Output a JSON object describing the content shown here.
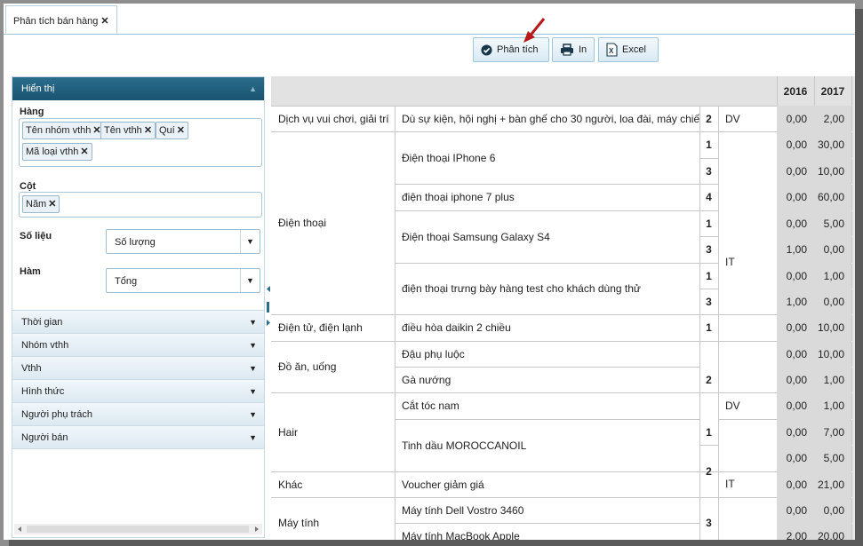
{
  "tab": {
    "label": "Phân tích bán hàng"
  },
  "toolbar": {
    "analyze_label": "Phân tích",
    "print_label": "In",
    "excel_label": "Excel"
  },
  "panel": {
    "title": "Hiển thị",
    "rows_label": "Hàng",
    "row_chips": [
      "Tên nhóm vthh",
      "Tên vthh",
      "Quí",
      "Mã loại vthh"
    ],
    "cols_label": "Cột",
    "col_chips": [
      "Năm"
    ],
    "measure_label": "Số liệu",
    "measure_value": "Số lượng",
    "func_label": "Hàm",
    "func_value": "Tổng",
    "filters": [
      "Thời gian",
      "Nhóm vthh",
      "Vthh",
      "Hình thức",
      "Người phụ trách",
      "Người bán"
    ]
  },
  "table": {
    "years": [
      "2016",
      "2017"
    ],
    "groups": [
      "Dịch vụ vui chơi, giải trí",
      "Điện thoại",
      "Điện tử, điện lạnh",
      "Đồ ăn, uống",
      "Hair",
      "Khác",
      "Máy tính"
    ],
    "items": [
      "Dù sự kiện, hội nghị + bàn ghế cho 30 người, loa đài, máy chiếu",
      "Điện thoại IPhone 6",
      "điện thoại iphone 7 plus",
      "Điện thoại Samsung Galaxy S4",
      "điện thoại trưng bày hàng test cho khách dùng thử",
      "điều hòa daikin 2 chiều",
      "Đậu phụ luộc",
      "Gà nướng",
      "Cắt tóc nam",
      "Tinh dầu MOROCCANOIL",
      "Voucher giảm giá",
      "Máy tính Dell Vostro 3460",
      "Máy tính MacBook Apple"
    ],
    "quarters": [
      "2",
      "1",
      "3",
      "4",
      "1",
      "3",
      "1",
      "3",
      "1",
      "2",
      "1",
      "2",
      "3"
    ],
    "types": [
      "DV",
      "IT",
      "DV",
      "IT"
    ],
    "values_2016": [
      "0,00",
      "0,00",
      "0,00",
      "0,00",
      "0,00",
      "1,00",
      "0,00",
      "1,00",
      "0,00",
      "0,00",
      "0,00",
      "0,00",
      "0,00",
      "0,00",
      "0,00",
      "0,00",
      "2,00",
      "1,00"
    ],
    "values_2017": [
      "2,00",
      "30,00",
      "10,00",
      "60,00",
      "5,00",
      "0,00",
      "1,00",
      "0,00",
      "10,00",
      "10,00",
      "1,00",
      "1,00",
      "7,00",
      "5,00",
      "21,00",
      "0,00",
      "20,00"
    ]
  }
}
